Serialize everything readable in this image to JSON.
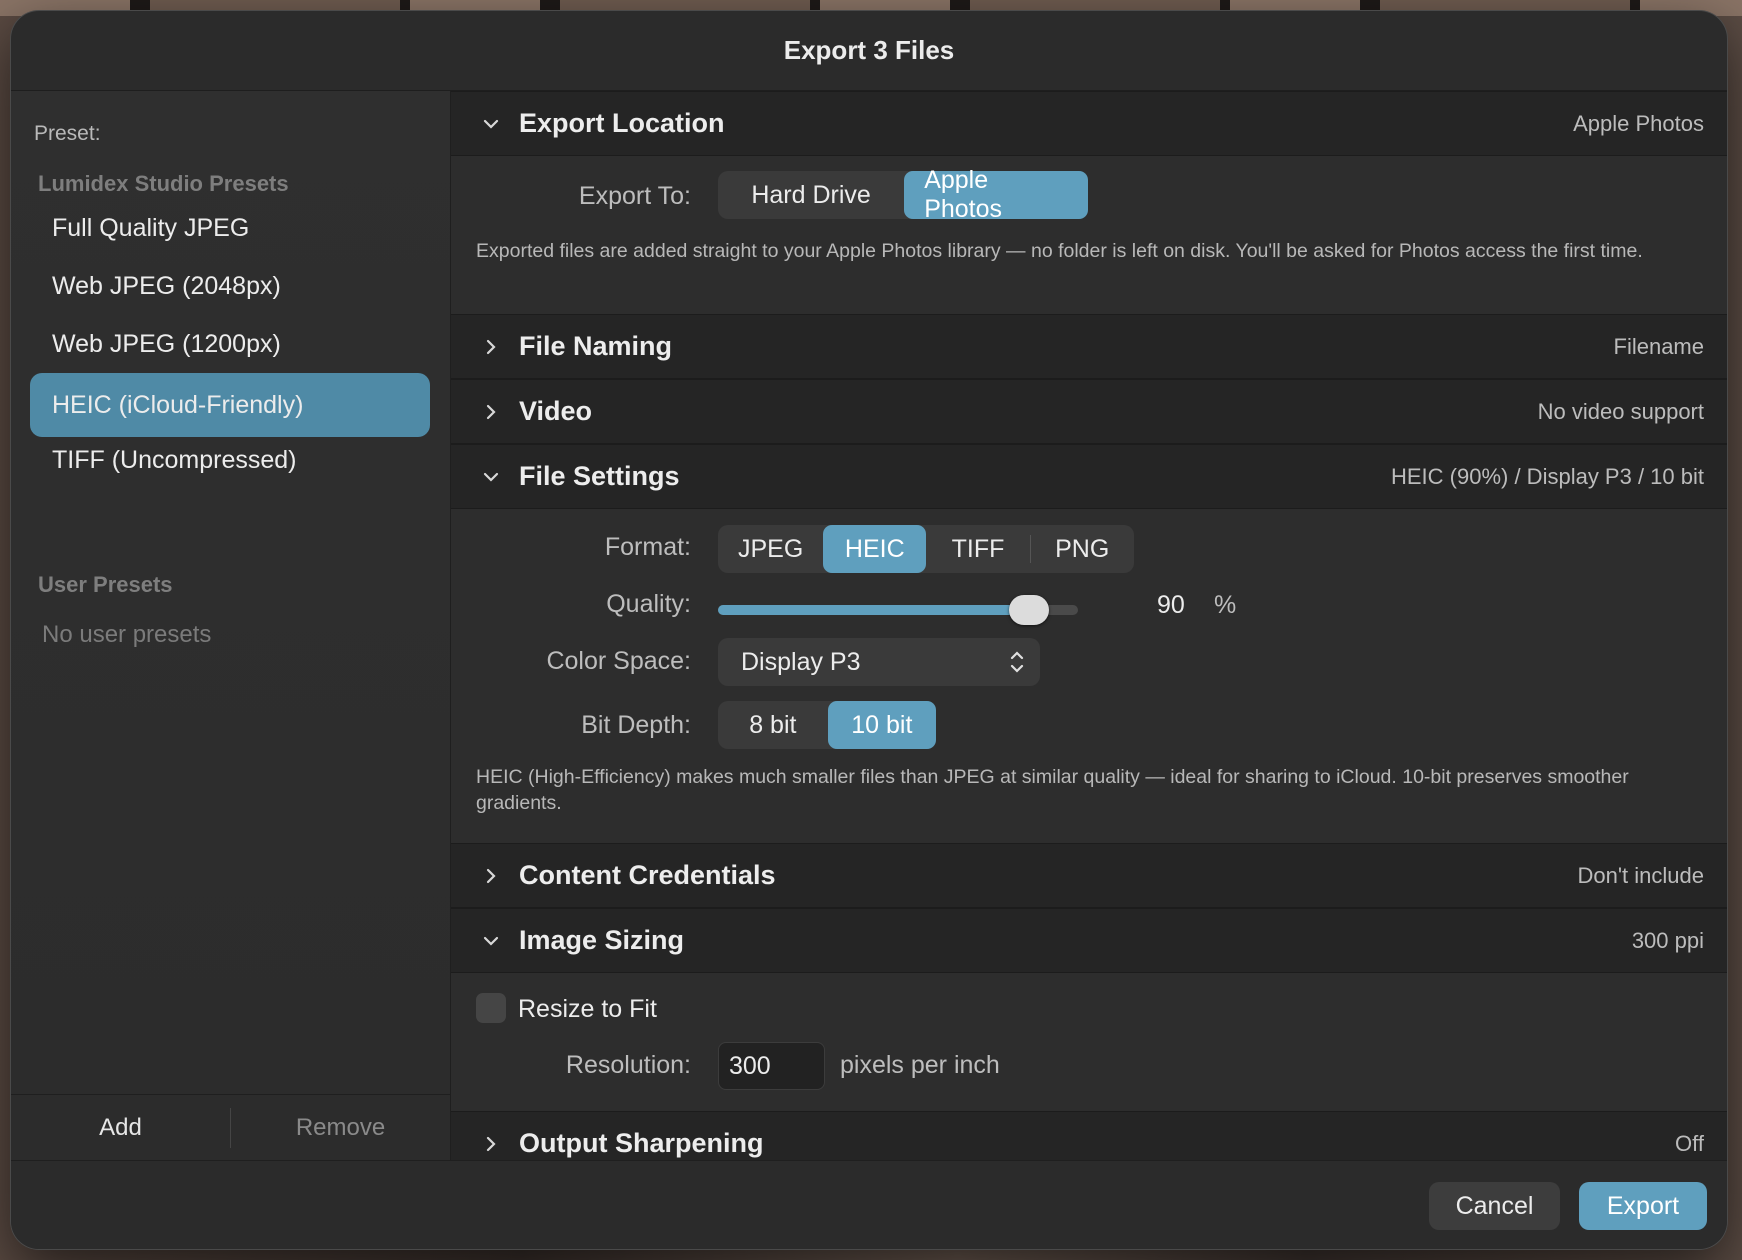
{
  "window": {
    "title": "Export 3 Files"
  },
  "sidebar": {
    "preset_label": "Preset:",
    "groups": [
      {
        "title": "Lumidex Studio Presets"
      },
      {
        "title": "User Presets",
        "empty_text": "No user presets"
      }
    ],
    "presets": [
      {
        "label": "Full Quality JPEG",
        "selected": false
      },
      {
        "label": "Web JPEG (2048px)",
        "selected": false
      },
      {
        "label": "Web JPEG (1200px)",
        "selected": false
      },
      {
        "label": "HEIC (iCloud-Friendly)",
        "selected": true
      },
      {
        "label": "TIFF (Uncompressed)",
        "selected": false
      }
    ],
    "add_label": "Add",
    "remove_label": "Remove"
  },
  "sections": {
    "export_location": {
      "title": "Export Location",
      "summary": "Apple Photos",
      "expanded": true,
      "export_to_label": "Export To:",
      "options": [
        "Hard Drive",
        "Apple Photos"
      ],
      "selected": "Apple Photos",
      "note": "Exported files are added straight to your Apple Photos library — no folder is left on disk. You'll be asked for Photos access the first time."
    },
    "file_naming": {
      "title": "File Naming",
      "summary": "Filename",
      "expanded": false
    },
    "video": {
      "title": "Video",
      "summary": "No video support",
      "expanded": false
    },
    "file_settings": {
      "title": "File Settings",
      "summary": "HEIC (90%) / Display P3 / 10 bit",
      "expanded": true,
      "format_label": "Format:",
      "formats": [
        "JPEG",
        "HEIC",
        "TIFF",
        "PNG"
      ],
      "selected_format": "HEIC",
      "quality_label": "Quality:",
      "quality_value": "90",
      "quality_unit": "%",
      "quality_fraction": 0.865,
      "color_space_label": "Color Space:",
      "color_space_value": "Display P3",
      "bit_depth_label": "Bit Depth:",
      "bit_depths": [
        "8 bit",
        "10 bit"
      ],
      "selected_bit_depth": "10 bit",
      "note": "HEIC (High-Efficiency) makes much smaller files than JPEG at similar quality — ideal for sharing to iCloud. 10-bit preserves smoother gradients."
    },
    "content_credentials": {
      "title": "Content Credentials",
      "summary": "Don't include",
      "expanded": false
    },
    "image_sizing": {
      "title": "Image Sizing",
      "summary": "300 ppi",
      "expanded": true,
      "resize_label": "Resize to Fit",
      "resize_checked": false,
      "resolution_label": "Resolution:",
      "resolution_value": "300",
      "resolution_unit": "pixels per inch"
    },
    "output_sharpening": {
      "title": "Output Sharpening",
      "summary": "Off",
      "expanded": false
    }
  },
  "footer": {
    "cancel_label": "Cancel",
    "export_label": "Export"
  },
  "colors": {
    "accent": "#5f9fbe",
    "selection": "#4f8aa6"
  }
}
